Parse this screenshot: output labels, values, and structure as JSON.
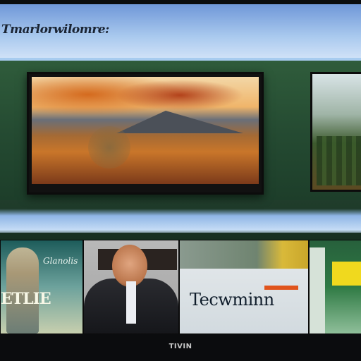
{
  "header": {
    "title": "Tmarlorwilomre:"
  },
  "featured": {
    "main_brand": "",
    "side_alt": ""
  },
  "row": {
    "tile1": {
      "title": "Glanolis",
      "big": "ETLIE"
    },
    "tile3": {
      "label": "Tecwminn"
    }
  },
  "footer": {
    "brand": "TIVIN"
  },
  "colors": {
    "accent": "#e0541c",
    "badge": "#f0d91e"
  }
}
